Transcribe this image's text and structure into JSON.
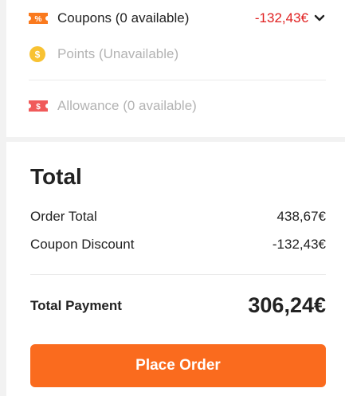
{
  "options": {
    "coupons": {
      "label": "Coupons (0 available)",
      "value": "-132,43€",
      "icon": "coupon-icon"
    },
    "points": {
      "label": "Points (Unavailable)",
      "icon": "coin-icon"
    },
    "allowance": {
      "label": "Allowance (0 available)",
      "icon": "allowance-ticket-icon"
    }
  },
  "total": {
    "title": "Total",
    "order_total_label": "Order Total",
    "order_total_value": "438,67€",
    "coupon_discount_label": "Coupon Discount",
    "coupon_discount_value": "-132,43€",
    "total_payment_label": "Total Payment",
    "total_payment_value": "306,24€"
  },
  "actions": {
    "place_order_label": "Place Order"
  },
  "colors": {
    "accent": "#fa6b1e",
    "discount_red": "#e02020",
    "disabled_gray": "#b3b3b3"
  }
}
